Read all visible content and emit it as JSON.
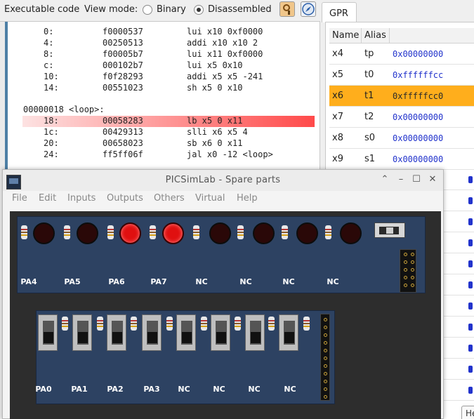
{
  "topbar": {
    "executable_label": "Executable code",
    "view_mode_label": "View mode:",
    "options": [
      {
        "label": "Binary",
        "selected": false
      },
      {
        "label": "Disassembled",
        "selected": true
      }
    ],
    "tools": [
      "brush-search-icon",
      "compass-icon"
    ]
  },
  "code": {
    "lines": [
      {
        "addr": "0:",
        "hex": "f0000537",
        "asm": "lui x10 0xf0000"
      },
      {
        "addr": "4:",
        "hex": "00250513",
        "asm": "addi x10 x10 2"
      },
      {
        "addr": "8:",
        "hex": "f00005b7",
        "asm": "lui x11 0xf0000"
      },
      {
        "addr": "c:",
        "hex": "000102b7",
        "asm": "lui x5 0x10"
      },
      {
        "addr": "10:",
        "hex": "f0f28293",
        "asm": "addi x5 x5 -241"
      },
      {
        "addr": "14:",
        "hex": "00551023",
        "asm": "sh x5 0 x10"
      }
    ],
    "label": "00000018 <loop>:",
    "loop_lines": [
      {
        "addr": "18:",
        "hex": "00058283",
        "asm": "lb x5 0 x11"
      },
      {
        "addr": "1c:",
        "hex": "00429313",
        "asm": "slli x6 x5 4"
      },
      {
        "addr": "20:",
        "hex": "00658023",
        "asm": "sb x6 0 x11"
      },
      {
        "addr": "24:",
        "hex": "ff5ff06f",
        "asm": "jal x0 -12 <loop>"
      }
    ],
    "highlighted_addr": "18:"
  },
  "gpr": {
    "tab_label": "GPR",
    "columns": [
      "Name",
      "Alias"
    ],
    "rows": [
      {
        "name": "x4",
        "alias": "tp",
        "value": "0x00000000",
        "selected": false
      },
      {
        "name": "x5",
        "alias": "t0",
        "value": "0xffffffcc",
        "selected": false
      },
      {
        "name": "x6",
        "alias": "t1",
        "value": "0xfffffcc0",
        "selected": true
      },
      {
        "name": "x7",
        "alias": "t2",
        "value": "0x00000000",
        "selected": false
      },
      {
        "name": "x8",
        "alias": "s0",
        "value": "0x00000000",
        "selected": false
      },
      {
        "name": "x9",
        "alias": "s1",
        "value": "0x00000000",
        "selected": false
      }
    ],
    "bottom_button": "He"
  },
  "window": {
    "title": "PICSimLab - Spare parts",
    "menus": [
      "File",
      "Edit",
      "Inputs",
      "Outputs",
      "Others",
      "Virtual",
      "Help"
    ],
    "controls": [
      "chevron-up-icon",
      "minimize-icon",
      "maximize-icon",
      "close-icon"
    ],
    "control_glyphs": [
      "⌃",
      "–",
      "☐",
      "✕"
    ]
  },
  "leds": {
    "labels": [
      "PA4",
      "PA5",
      "PA6",
      "PA7",
      "NC",
      "NC",
      "NC",
      "NC"
    ],
    "states": [
      false,
      false,
      true,
      true,
      false,
      false,
      false,
      false
    ]
  },
  "switches": {
    "labels": [
      "PA0",
      "PA1",
      "PA2",
      "PA3",
      "NC",
      "NC",
      "NC",
      "NC"
    ]
  }
}
